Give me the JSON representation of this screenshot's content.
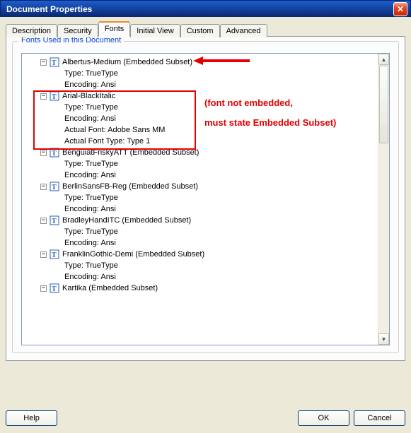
{
  "window": {
    "title": "Document Properties"
  },
  "tabs": {
    "description": "Description",
    "security": "Security",
    "fonts": "Fonts",
    "initial_view": "Initial View",
    "custom": "Custom",
    "advanced": "Advanced"
  },
  "group": {
    "label": "Fonts Used in this Document"
  },
  "fonts": [
    {
      "name": "Albertus-Medium (Embedded Subset)",
      "expanded": true,
      "details": [
        "Type: TrueType",
        "Encoding: Ansi"
      ]
    },
    {
      "name": "Arial-BlackItalic",
      "expanded": true,
      "details": [
        "Type: TrueType",
        "Encoding: Ansi",
        "Actual Font: Adobe Sans MM",
        "Actual Font Type: Type 1"
      ]
    },
    {
      "name": "BenguiatFriskyATT (Embedded Subset)",
      "expanded": true,
      "details": [
        "Type: TrueType",
        "Encoding: Ansi"
      ]
    },
    {
      "name": "BerlinSansFB-Reg (Embedded Subset)",
      "expanded": true,
      "details": [
        "Type: TrueType",
        "Encoding: Ansi"
      ]
    },
    {
      "name": "BradleyHandITC (Embedded Subset)",
      "expanded": true,
      "details": [
        "Type: TrueType",
        "Encoding: Ansi"
      ]
    },
    {
      "name": "FranklinGothic-Demi (Embedded Subset)",
      "expanded": true,
      "details": [
        "Type: TrueType",
        "Encoding: Ansi"
      ]
    },
    {
      "name": "Kartika (Embedded Subset)",
      "expanded": true,
      "details": []
    }
  ],
  "annotations": {
    "line1": "(font not embedded,",
    "line2": "must state Embedded Subset)"
  },
  "buttons": {
    "help": "Help",
    "ok": "OK",
    "cancel": "Cancel"
  },
  "glyphs": {
    "minus": "−",
    "close": "✕",
    "up": "▲",
    "down": "▼"
  }
}
